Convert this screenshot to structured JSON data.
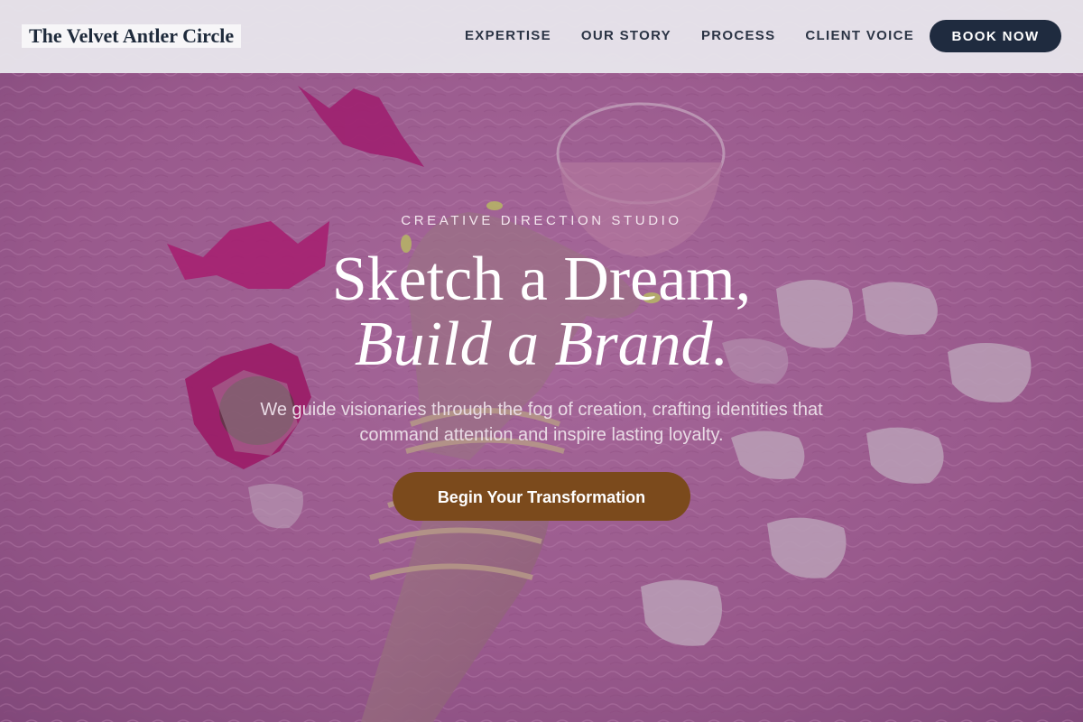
{
  "header": {
    "logo_text": "The Velvet Antler Circle",
    "nav": [
      {
        "label": "EXPERTISE"
      },
      {
        "label": "OUR STORY"
      },
      {
        "label": "PROCESS"
      },
      {
        "label": "CLIENT VOICE"
      }
    ],
    "cta_label": "BOOK NOW"
  },
  "hero": {
    "eyebrow": "CREATIVE DIRECTION STUDIO",
    "headline_line1": "Sketch a Dream,",
    "headline_line2": "Build a Brand.",
    "subtext": "We guide visionaries through the fog of creation, crafting identities that command attention and inspire lasting loyalty.",
    "cta_label": "Begin Your Transformation",
    "background_image": "pink-fur-hand-candy-petals-photo"
  },
  "colors": {
    "header_bg": "#e7e4eb",
    "nav_text": "#2b3445",
    "book_button_bg": "#1f2b3f",
    "hero_tint": "#b86fa6",
    "cta_bg": "#7b4a1c"
  }
}
